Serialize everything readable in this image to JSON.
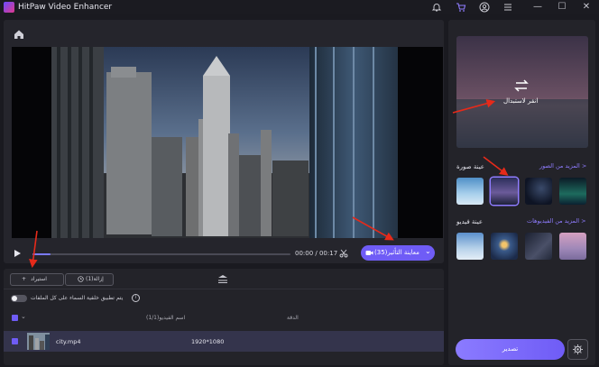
{
  "app": {
    "title": "HitPaw Video Enhancer"
  },
  "titlebar": {
    "icons": [
      "bell-icon",
      "cart-icon",
      "account-icon",
      "menu-icon"
    ],
    "minimize": "—",
    "maximize": "☐",
    "close": "✕"
  },
  "player": {
    "time": "00:00 / 00:17",
    "progress": 0.07,
    "preview_label": "معاينة التأثير(35)",
    "preview_chevron": "⌄"
  },
  "files": {
    "import_label": "استيراد",
    "remove_label": "إزالة(1)",
    "apply_sky_label": "يتم تطبيق خلفية السماء على كل الملفات",
    "columns": {
      "name": "اسم الفيديو(1/1)",
      "resolution": "الدقة"
    },
    "rows": [
      {
        "name": "city.mp4",
        "resolution": "1920*1080",
        "checked": true
      }
    ]
  },
  "sidebar": {
    "replace_label": "انقر لاستبدال",
    "more_images": "المزيد من الصور >",
    "image_sample": "عينة صورة",
    "more_videos": "المزيد من الفيديوهات >",
    "video_sample": "عينة فيديو",
    "export_label": "تصدير"
  },
  "colors": {
    "accent": "#6f5cf6",
    "arrow": "#e62a1a",
    "background": "#1a1a20"
  }
}
